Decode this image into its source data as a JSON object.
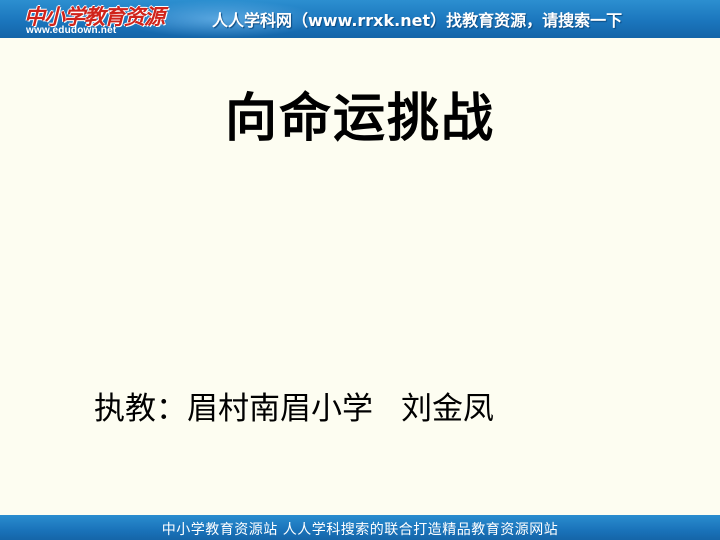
{
  "header": {
    "logo_text": "中小学教育资源",
    "logo_url": "www.edudown.net",
    "banner_text": "人人学科网（www.rrxk.net）找教育资源，请搜索一下"
  },
  "slide": {
    "title": "向命运挑战",
    "byline_label": "执教：眉村南眉小学",
    "teacher": "刘金凤"
  },
  "footer": {
    "text": "中小学教育资源站 人人学科搜索的联合打造精品教育资源网站"
  },
  "colors": {
    "banner_blue": "#1b76bd",
    "background": "#fdfdf1",
    "logo_red": "#d0241b"
  }
}
